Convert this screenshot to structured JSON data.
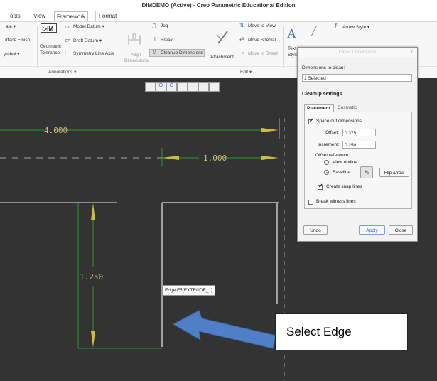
{
  "window": {
    "title": "DIMDEMO (Active) - Creo Parametric Educational Edition"
  },
  "tabs": [
    "Tools",
    "View",
    "Framework",
    "Format"
  ],
  "ribbon": {
    "col1": [
      "ate ▾",
      "urface Finish",
      "ymbol ▾"
    ],
    "geometric_tolerance": [
      "Geometric",
      "Tolerance"
    ],
    "datum_menu": [
      "Model Datum ▾",
      "Draft Datum ▾",
      "Symmetry Line Axis"
    ],
    "align": [
      "Align",
      "Dimensions"
    ],
    "jog": "Jog",
    "break": "Break",
    "cleanup": "Cleanup Dimensions",
    "attachment": "Attachment",
    "move_items": [
      "Move to View",
      "Move Special",
      "Move to Sheet"
    ],
    "text_style": [
      "Text",
      "Style"
    ],
    "arrow_style": "Arrow Style ▾",
    "annotations_group": "Annotations ▾",
    "edit_group": "Edit ▾"
  },
  "drawing": {
    "dim_top": "4.000",
    "dim_mid": "1.000",
    "dim_vertical": "1.250",
    "tooltip": "Edge:F5(EXTRUDE_1)"
  },
  "dialog": {
    "title": "Clean Dimensions",
    "close": "x",
    "dims_label": "Dimensions to clean:",
    "selected": "1 Selected",
    "cleanup_heading": "Cleanup settings",
    "tab_placement": "Placement",
    "tab_cosmetic": "Cosmetic",
    "space_out": "Space out dimensions",
    "offset_label": "Offset:",
    "offset_value": "0.375",
    "increment_label": "Increment:",
    "increment_value": "0.250",
    "offset_reference": "Offset reference:",
    "view_outline": "View outline",
    "baseline": "Baseline:",
    "flip_arrow": "Flip arrow",
    "create_snap": "Create snap lines",
    "break_witness": "Break witness lines",
    "undo": "Undo",
    "apply": "Apply",
    "close_btn": "Close"
  },
  "annotation": {
    "callout": "Select Edge"
  },
  "colors": {
    "canvas": "#333333",
    "dimension": "#2f9a2f",
    "dimension_text": "#c9c37a",
    "geometry": "#e8e8e8",
    "hidden": "#a5a5a5",
    "arrow_fill": "#4f7fc6",
    "arrowhead": "#c8c043"
  }
}
